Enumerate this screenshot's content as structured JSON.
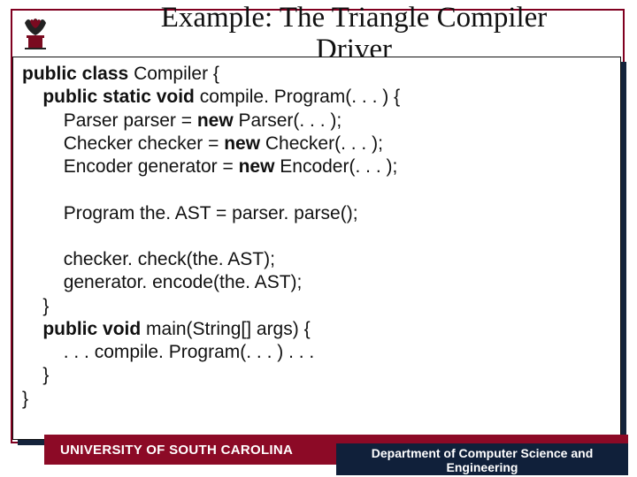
{
  "title_line1": "Example: The Triangle Compiler",
  "title_line2": "Driver",
  "code": {
    "l1a": "public class ",
    "l1b": "Compiler {",
    "l2a": "public static void ",
    "l2b": "compile. Program(. . . ) {",
    "l3a": "Parser parser = ",
    "l3b": "new ",
    "l3c": "Parser(. . . );",
    "l4a": "Checker checker = ",
    "l4b": "new ",
    "l4c": "Checker(. . . );",
    "l5a": "Encoder generator = ",
    "l5b": "new ",
    "l5c": "Encoder(. . . );",
    "l6": "Program the. AST = parser. parse();",
    "l7": "checker. check(the. AST);",
    "l8": "generator. encode(the. AST);",
    "l9": "}",
    "l10a": "public void ",
    "l10b": "main(String[] args) {",
    "l11": ". . . compile. Program(. . . ) . . .",
    "l12": "}",
    "l13": "}"
  },
  "footer_university": "UNIVERSITY OF SOUTH CAROLINA",
  "footer_dept_line1": "Department of Computer Science and",
  "footer_dept_line2": "Engineering",
  "colors": {
    "accent": "#8c0a26",
    "dark": "#10203a"
  }
}
